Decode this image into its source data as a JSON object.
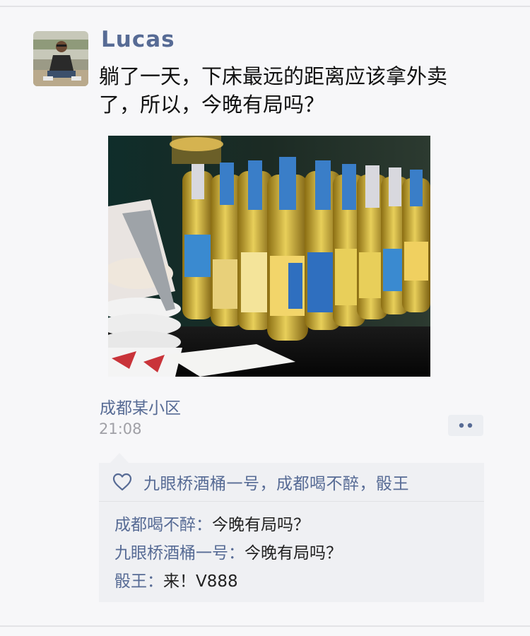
{
  "post": {
    "username": "Lucas",
    "text": "躺了一天，下床最远的距离应该拿外卖\n了，所以，今晚有局吗？",
    "location": "成都某小区",
    "time": "21:08"
  },
  "likes": {
    "names": "九眼桥酒桶一号，成都喝不醉，骰王"
  },
  "comments": [
    {
      "author": "成都喝不醉",
      "text": "今晚有局吗？"
    },
    {
      "author": "九眼桥酒桶一号",
      "text": "今晚有局吗？"
    },
    {
      "author": "骰王",
      "text": "来！V888"
    }
  ],
  "icons": {
    "like": "heart-outline-icon",
    "more": "more-dots-icon"
  },
  "colors": {
    "link": "#576b95",
    "text": "#111111",
    "comment_bg": "#eff0f3"
  }
}
